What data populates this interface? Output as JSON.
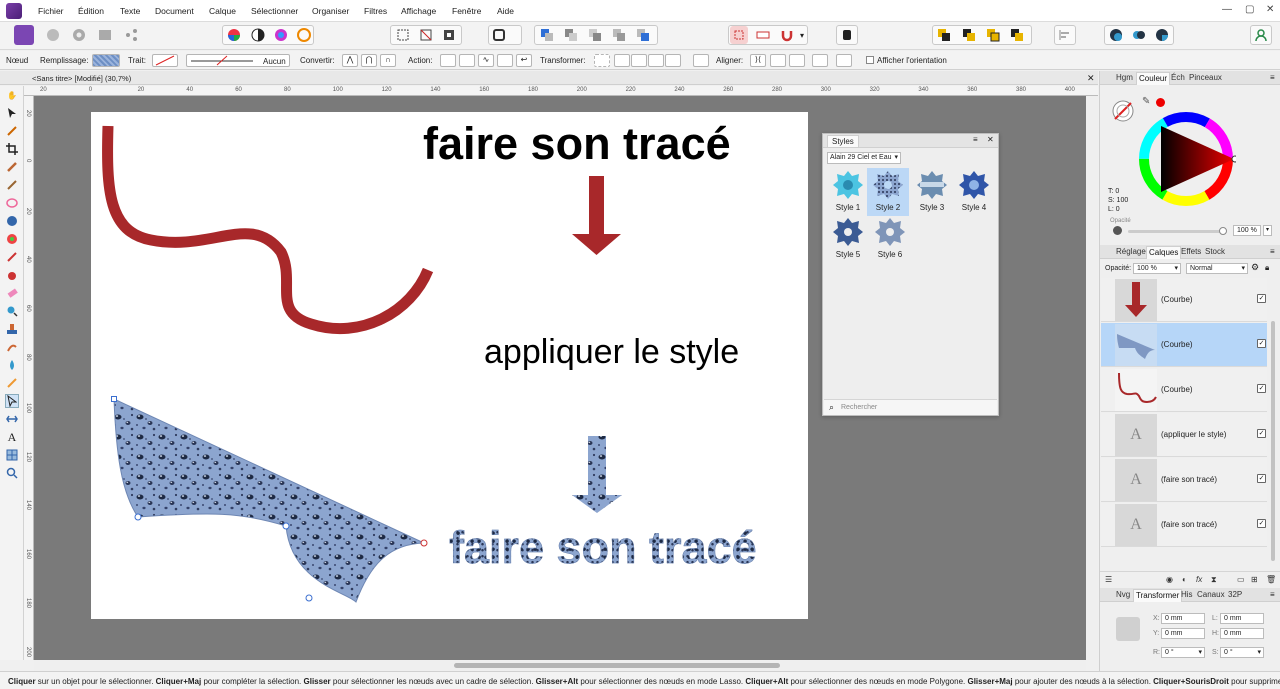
{
  "menu": [
    "Fichier",
    "Édition",
    "Texte",
    "Document",
    "Calque",
    "Sélectionner",
    "Organiser",
    "Filtres",
    "Affichage",
    "Fenêtre",
    "Aide"
  ],
  "context_bar": {
    "node_label": "Nœud",
    "fill_label": "Remplissage:",
    "stroke_label": "Trait:",
    "stroke_value": "Aucun",
    "convert_label": "Convertir:",
    "action_label": "Action:",
    "transform_label": "Transformer:",
    "align_label": "Aligner:",
    "show_orientation": "Afficher l'orientation"
  },
  "document_tab": "<Sans titre> [Modifié] (30,7%)",
  "canvas": {
    "title_text": "faire son tracé",
    "middle_text": "appliquer le style",
    "styled_text": "faire son tracé"
  },
  "ruler": {
    "h": [
      "20",
      "0",
      "20",
      "40",
      "60",
      "80",
      "100",
      "120",
      "140",
      "160",
      "180",
      "200",
      "220",
      "240",
      "260",
      "280",
      "300",
      "320",
      "340",
      "360",
      "380",
      "400"
    ],
    "v": [
      "20",
      "0",
      "20",
      "40",
      "60",
      "80",
      "100",
      "120",
      "140",
      "160",
      "180",
      "200",
      "220"
    ]
  },
  "styles_panel": {
    "title": "Styles",
    "category": "Alain 29 Ciel et Eau",
    "items": [
      "Style 1",
      "Style 2",
      "Style 3",
      "Style 4",
      "Style 5",
      "Style 6"
    ],
    "search_placeholder": "Rechercher"
  },
  "color_panel": {
    "tabs": [
      "Hgm",
      "Couleur",
      "Éch",
      "Pinceaux"
    ],
    "t": "T: 0",
    "s": "S: 100",
    "l": "L: 0",
    "opacity_label": "Opacité",
    "opacity_value": "100 %"
  },
  "layers_panel": {
    "tabs": [
      "Réglage",
      "Calques",
      "Effets",
      "Stock"
    ],
    "opacity_label": "Opacité:",
    "opacity_value": "100 %",
    "blend_mode": "Normal",
    "layers": [
      {
        "name": "(Courbe)",
        "kind": "arrow-red"
      },
      {
        "name": "(Courbe)",
        "kind": "shape-blue",
        "selected": true
      },
      {
        "name": "(Courbe)",
        "kind": "curve-red"
      },
      {
        "name": "(appliquer le style)",
        "kind": "text"
      },
      {
        "name": "(faire son tracé)",
        "kind": "text"
      },
      {
        "name": "(faire son tracé)",
        "kind": "text"
      }
    ]
  },
  "transform_panel": {
    "tabs": [
      "Nvg",
      "Transformer",
      "His",
      "Canaux",
      "32P"
    ],
    "x_label": "X:",
    "x_value": "0 mm",
    "y_label": "Y:",
    "y_value": "0 mm",
    "w_label": "L:",
    "w_value": "0 mm",
    "h_label": "H:",
    "h_value": "0 mm",
    "r_label": "R:",
    "r_value": "0 °",
    "s_label": "S:",
    "s_value": "0 °"
  },
  "status": {
    "parts": [
      {
        "b": true,
        "t": "Cliquer"
      },
      {
        "b": false,
        "t": " sur un objet pour le sélectionner. "
      },
      {
        "b": true,
        "t": "Cliquer+Maj"
      },
      {
        "b": false,
        "t": " pour compléter la sélection. "
      },
      {
        "b": true,
        "t": "Glisser"
      },
      {
        "b": false,
        "t": " pour sélectionner les nœuds avec un cadre de sélection. "
      },
      {
        "b": true,
        "t": "Glisser+Alt"
      },
      {
        "b": false,
        "t": " pour sélectionner des nœuds en mode Lasso. "
      },
      {
        "b": true,
        "t": "Cliquer+Alt"
      },
      {
        "b": false,
        "t": " pour sélectionner des nœuds en mode Polygone. "
      },
      {
        "b": true,
        "t": "Glisser+Maj"
      },
      {
        "b": false,
        "t": " pour ajouter des nœuds à la sélection. "
      },
      {
        "b": true,
        "t": "Cliquer+SourisDroit"
      },
      {
        "b": false,
        "t": " pour supprimer d"
      }
    ]
  },
  "colors": {
    "accent_red": "#a8282a",
    "water_blue": "#8ca5cf",
    "selection_blue": "#b6d6f8"
  }
}
